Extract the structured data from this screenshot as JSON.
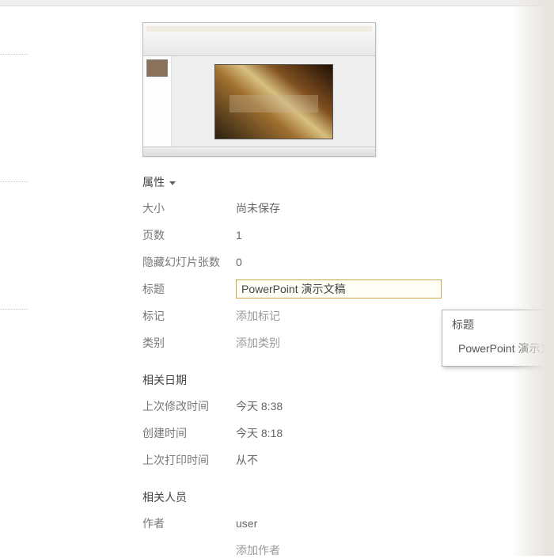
{
  "sections": {
    "properties": "属性",
    "related_dates": "相关日期",
    "related_people": "相关人员"
  },
  "properties": {
    "size_label": "大小",
    "size_value": "尚未保存",
    "pages_label": "页数",
    "pages_value": "1",
    "hidden_label": "隐藏幻灯片张数",
    "hidden_value": "0",
    "title_label": "标题",
    "title_value": "PowerPoint 演示文稿",
    "tags_label": "标记",
    "tags_placeholder": "添加标记",
    "category_label": "类别",
    "category_placeholder": "添加类别"
  },
  "dates": {
    "modified_label": "上次修改时间",
    "modified_value": "今天 8:38",
    "created_label": "创建时间",
    "created_value": "今天 8:18",
    "printed_label": "上次打印时间",
    "printed_value": "从不"
  },
  "people": {
    "author_label": "作者",
    "author_value": "user",
    "add_author_placeholder": "添加作者"
  },
  "tooltip": {
    "title": "标题",
    "body": "PowerPoint 演示文稿"
  }
}
